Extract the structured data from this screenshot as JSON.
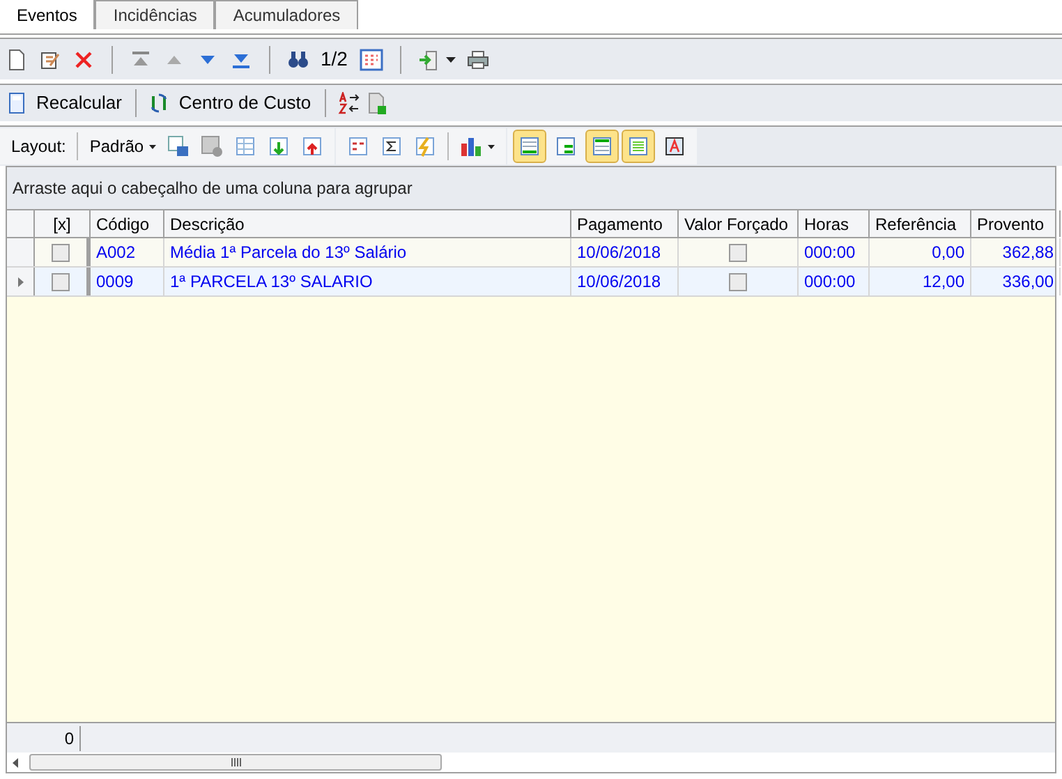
{
  "tabs": [
    {
      "label": "Eventos",
      "selected": true
    },
    {
      "label": "Incidências",
      "selected": false
    },
    {
      "label": "Acumuladores",
      "selected": false
    }
  ],
  "toolbar": {
    "page": "1/2"
  },
  "actions": [
    {
      "label": "Recalcular"
    },
    {
      "label": "Centro de Custo"
    }
  ],
  "layout_bar": {
    "label": "Layout:",
    "preset": "Padrão",
    "view_buttons": [
      {
        "selected": true
      },
      {
        "selected": false
      },
      {
        "selected": true
      },
      {
        "selected": true
      },
      {
        "selected": false
      }
    ]
  },
  "group_panel": {
    "hint": "Arraste aqui o cabeçalho de uma coluna para agrupar"
  },
  "table": {
    "columns": [
      "[x]",
      "Código",
      "Descrição",
      "Pagamento",
      "Valor Forçado",
      "Horas",
      "Referência",
      "Provento"
    ],
    "rows": [
      {
        "selected": false,
        "cells": [
          {
            "kind": "checkbox",
            "checked": false
          },
          {
            "kind": "text",
            "text": "A002"
          },
          {
            "kind": "text",
            "text": "Média 1ª Parcela do 13º Salário"
          },
          {
            "kind": "text",
            "text": "10/06/2018"
          },
          {
            "kind": "checkbox",
            "checked": false
          },
          {
            "kind": "text",
            "text": "000:00"
          },
          {
            "kind": "number",
            "text": "0,00"
          },
          {
            "kind": "number",
            "text": "362,88"
          }
        ]
      },
      {
        "selected": true,
        "cells": [
          {
            "kind": "checkbox",
            "checked": false
          },
          {
            "kind": "text",
            "text": "0009"
          },
          {
            "kind": "text",
            "text": "1ª PARCELA 13º SALARIO"
          },
          {
            "kind": "text",
            "text": "10/06/2018"
          },
          {
            "kind": "checkbox",
            "checked": false
          },
          {
            "kind": "text",
            "text": "000:00"
          },
          {
            "kind": "number",
            "text": "12,00"
          },
          {
            "kind": "number",
            "text": "336,00"
          }
        ]
      }
    ]
  },
  "footer": {
    "count": "0"
  }
}
